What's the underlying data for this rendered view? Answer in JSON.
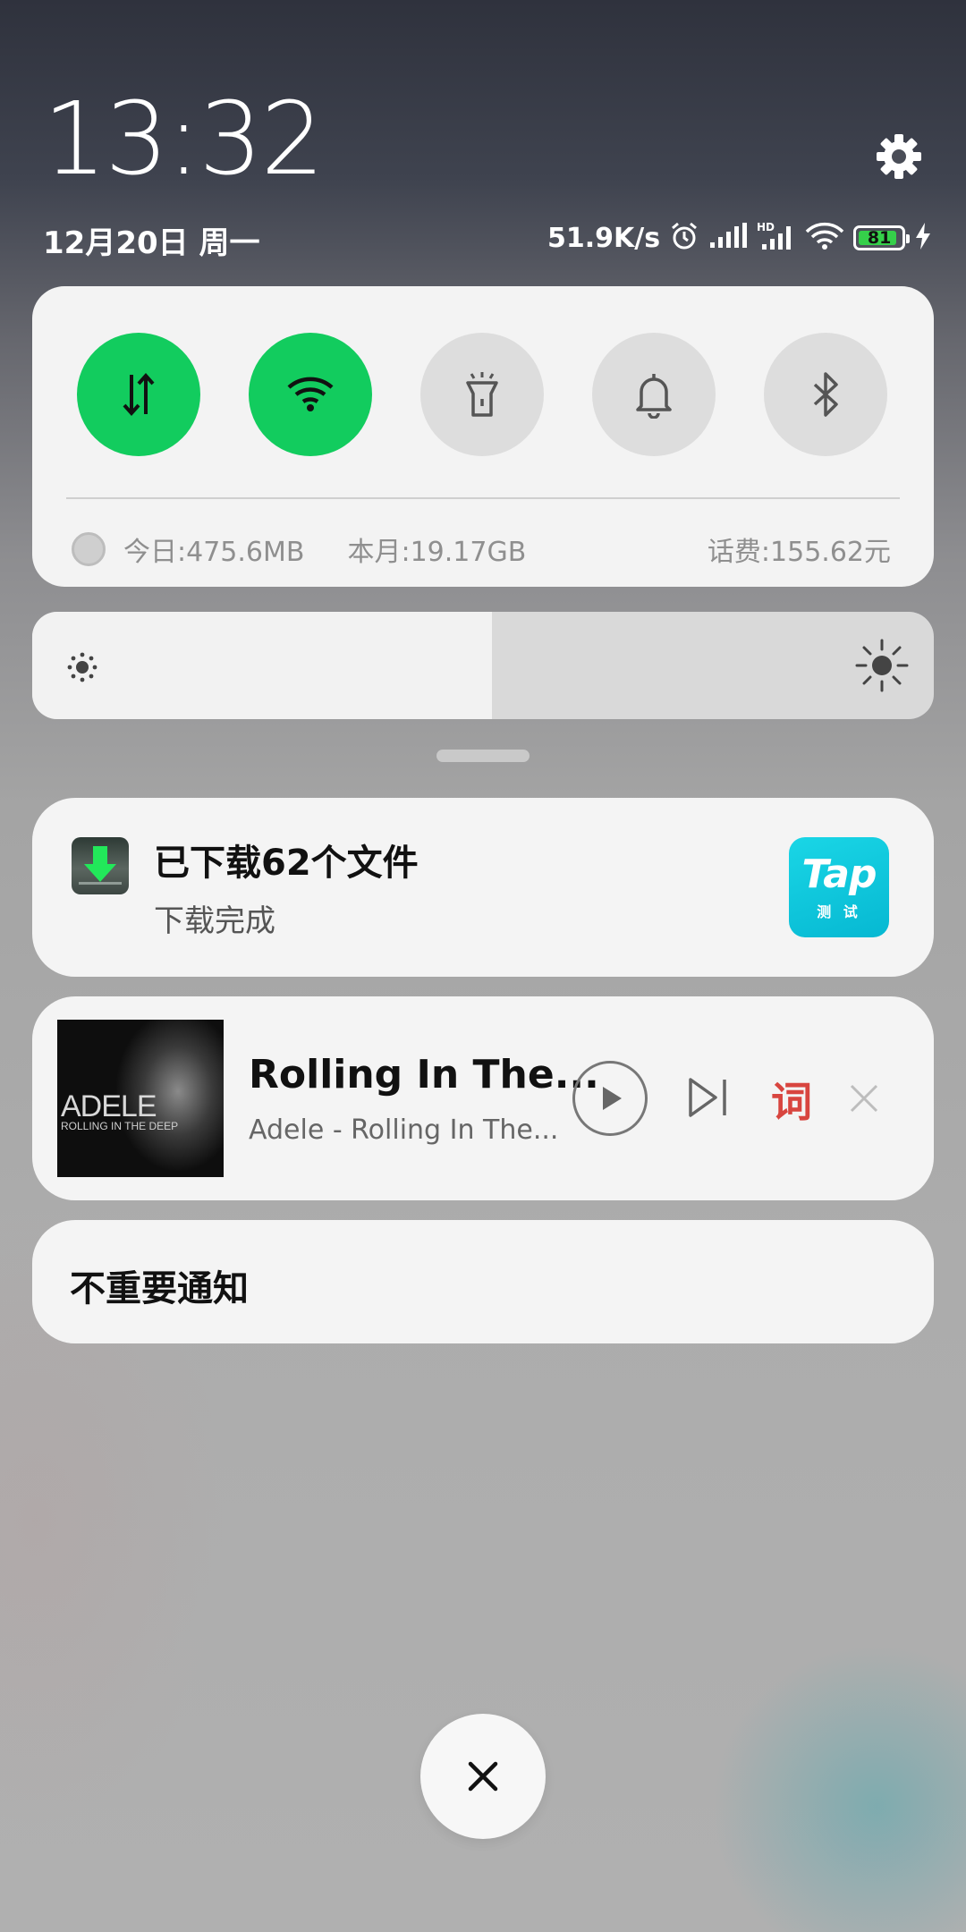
{
  "header": {
    "time": "13:32",
    "date": "12月20日 周一",
    "net_speed": "51.9K/s",
    "battery_level": "81",
    "icons": [
      "alarm-icon",
      "signal-icon",
      "hd-signal-icon",
      "wifi-icon",
      "battery-icon",
      "charging-icon",
      "gear-icon"
    ]
  },
  "quick_settings": {
    "tiles": [
      {
        "name": "mobile-data",
        "icon": "data-arrows-icon",
        "state": "on"
      },
      {
        "name": "wifi",
        "icon": "wifi-icon",
        "state": "on"
      },
      {
        "name": "flashlight",
        "icon": "flashlight-icon",
        "state": "off"
      },
      {
        "name": "sound",
        "icon": "bell-icon",
        "state": "off"
      },
      {
        "name": "bluetooth",
        "icon": "bluetooth-icon",
        "state": "off"
      }
    ],
    "usage": {
      "today": "今日:475.6MB",
      "month": "本月:19.17GB",
      "fee": "话费:155.62元"
    },
    "colors": {
      "on": "#12cc5e",
      "off": "#dddddd"
    }
  },
  "brightness": {
    "level_fraction": 0.51
  },
  "notifications": {
    "download": {
      "title": "已下载62个文件",
      "subtitle": "下载完成",
      "app_logo_text": "Tap",
      "app_logo_subtext": "测 试"
    },
    "music": {
      "song": "Rolling In The...",
      "artist_album": "Adele - Rolling In The...",
      "album_art_artist": "ADELE",
      "album_art_title": "ROLLING IN THE DEEP",
      "lyrics_label": "词",
      "lyrics_color": "#d8453f"
    },
    "unimportant": {
      "label": "不重要通知"
    }
  }
}
